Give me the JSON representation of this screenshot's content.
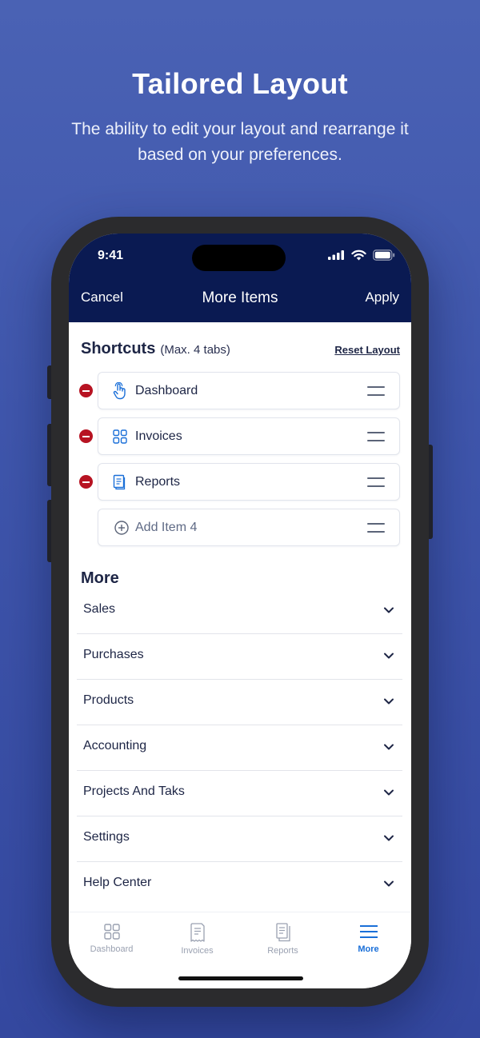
{
  "promo": {
    "title": "Tailored Layout",
    "subtitle": "The ability to edit your layout and rearrange it based on your preferences."
  },
  "status_bar": {
    "time": "9:41",
    "icons": [
      "signal-icon",
      "wifi-icon",
      "battery-icon"
    ]
  },
  "nav": {
    "cancel": "Cancel",
    "title": "More Items",
    "apply": "Apply"
  },
  "shortcuts": {
    "title": "Shortcuts",
    "note": "(Max. 4 tabs)",
    "reset": "Reset Layout",
    "items": [
      {
        "label": "Dashboard",
        "icon": "touch-hand-icon"
      },
      {
        "label": "Invoices",
        "icon": "grid-icon"
      },
      {
        "label": "Reports",
        "icon": "document-icon"
      }
    ],
    "add_item": {
      "label": "Add Item 4",
      "icon": "plus-circle-icon"
    }
  },
  "more": {
    "title": "More",
    "items": [
      "Sales",
      "Purchases",
      "Products",
      "Accounting",
      "Projects And Taks",
      "Settings",
      "Help Center"
    ]
  },
  "tabbar": {
    "tabs": [
      {
        "label": "Dashboard",
        "icon": "grid-icon",
        "active": false
      },
      {
        "label": "Invoices",
        "icon": "receipt-icon",
        "active": false
      },
      {
        "label": "Reports",
        "icon": "documents-icon",
        "active": false
      },
      {
        "label": "More",
        "icon": "menu-icon",
        "active": true
      }
    ]
  },
  "colors": {
    "background": "#4a62b4",
    "nav_bar": "#0a1a52",
    "remove": "#b71322",
    "active_tab": "#1a6fd8",
    "shortcut_icon": "#1a6fd8"
  }
}
